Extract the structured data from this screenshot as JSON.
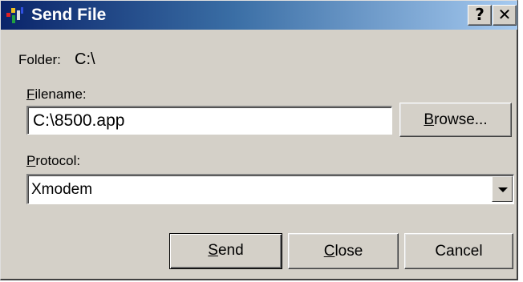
{
  "window": {
    "title": "Send File",
    "help_label": "?",
    "close_label": "✕"
  },
  "folder": {
    "label": "Folder:",
    "value": "C:\\"
  },
  "filename": {
    "label_hotkey": "F",
    "label_rest": "ilename:",
    "value": "C:\\8500.app"
  },
  "browse": {
    "label_hotkey": "B",
    "label_rest": "rowse..."
  },
  "protocol": {
    "label_hotkey": "P",
    "label_rest": "rotocol:",
    "selected": "Xmodem"
  },
  "buttons": {
    "send_hotkey": "S",
    "send_rest": "end",
    "close_hotkey": "C",
    "close_rest": "lose",
    "cancel": "Cancel"
  },
  "icons": {
    "app": "app-icon",
    "dropdown": "chevron-down-icon"
  },
  "colors": {
    "titlebar_start": "#0a246a",
    "titlebar_end": "#a6caf0",
    "dialog_face": "#d4d0c8"
  }
}
